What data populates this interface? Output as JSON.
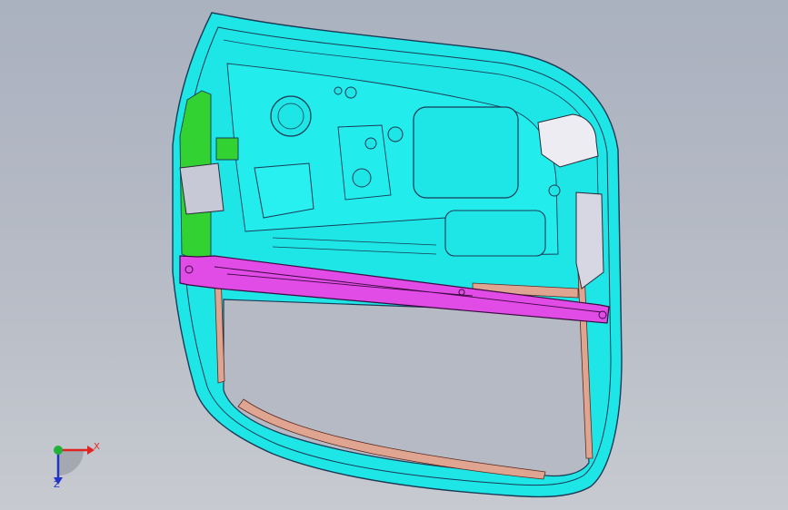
{
  "viewport": {
    "background_top": "#aab1bf",
    "background_bottom": "#c7cad0"
  },
  "model": {
    "panel_color": "#1ee6e6",
    "outline_color": "#1a3a55",
    "reinforcement_color": "#e0a590",
    "crossbar_color": "#e14be6",
    "hinge_strip_color": "#32d232",
    "bracket_color": "#c8c9d6"
  },
  "triad": {
    "x_label": "X",
    "z_label": "Z",
    "x_color": "#e0241f",
    "y_color": "#1fb33a",
    "z_color": "#2233c8"
  }
}
